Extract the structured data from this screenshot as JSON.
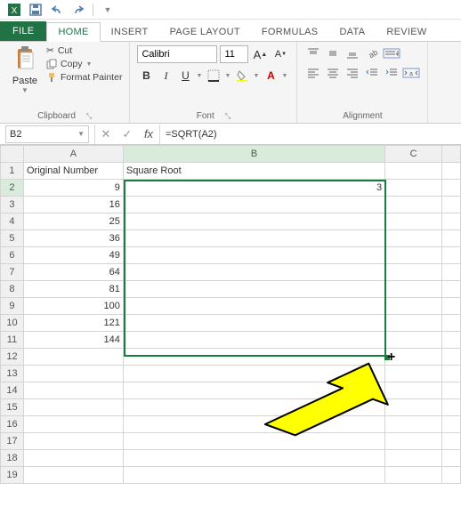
{
  "qat": {
    "undo_tip": "Undo",
    "redo_tip": "Redo",
    "save_tip": "Save"
  },
  "tabs": {
    "file": "FILE",
    "home": "HOME",
    "insert": "INSERT",
    "page_layout": "PAGE LAYOUT",
    "formulas": "FORMULAS",
    "data": "DATA",
    "review": "REVIEW"
  },
  "ribbon": {
    "clipboard": {
      "paste": "Paste",
      "cut": "Cut",
      "copy": "Copy",
      "format_painter": "Format Painter",
      "label": "Clipboard"
    },
    "font": {
      "name": "Calibri",
      "size": "11",
      "bold": "B",
      "italic": "I",
      "underline": "U",
      "label": "Font"
    },
    "alignment": {
      "label": "Alignment"
    }
  },
  "namebox": "B2",
  "formula": "=SQRT(A2)",
  "columns": {
    "A": "A",
    "B": "B",
    "C": "C",
    "D": ""
  },
  "headers": {
    "A": "Original Number",
    "B": "Square Root"
  },
  "data_rows": [
    {
      "n": "2",
      "A": "9",
      "B": "3"
    },
    {
      "n": "3",
      "A": "16",
      "B": ""
    },
    {
      "n": "4",
      "A": "25",
      "B": ""
    },
    {
      "n": "5",
      "A": "36",
      "B": ""
    },
    {
      "n": "6",
      "A": "49",
      "B": ""
    },
    {
      "n": "7",
      "A": "64",
      "B": ""
    },
    {
      "n": "8",
      "A": "81",
      "B": ""
    },
    {
      "n": "9",
      "A": "100",
      "B": ""
    },
    {
      "n": "10",
      "A": "121",
      "B": ""
    },
    {
      "n": "11",
      "A": "144",
      "B": ""
    }
  ],
  "empty_rows": [
    "12",
    "13",
    "14",
    "15",
    "16",
    "17",
    "18",
    "19"
  ],
  "colors": {
    "brand": "#217346",
    "selection": "#1a7b40",
    "arrow_fill": "#ffff00",
    "arrow_stroke": "#000000"
  },
  "chart_data": {
    "type": "table",
    "title": "",
    "columns": [
      "Original Number",
      "Square Root"
    ],
    "rows": [
      [
        9,
        3
      ],
      [
        16,
        null
      ],
      [
        25,
        null
      ],
      [
        36,
        null
      ],
      [
        49,
        null
      ],
      [
        64,
        null
      ],
      [
        81,
        null
      ],
      [
        100,
        null
      ],
      [
        121,
        null
      ],
      [
        144,
        null
      ]
    ],
    "active_cell": "B2",
    "active_formula": "=SQRT(A2)",
    "fill_target_range": "B2:B11"
  }
}
